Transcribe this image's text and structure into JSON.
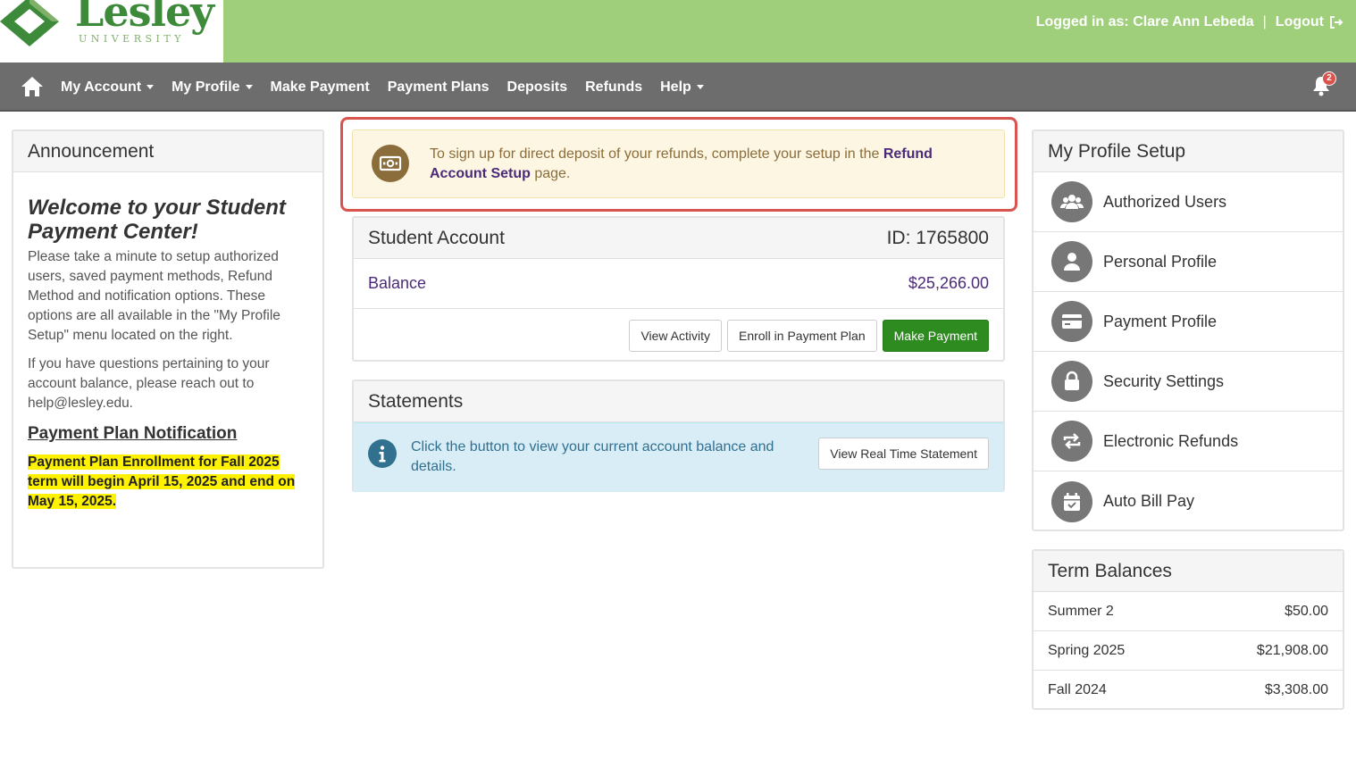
{
  "header": {
    "logo_text": "Lesley",
    "logo_sub": "UNIVERSITY",
    "logged_in_label": "Logged in as: Clare Ann Lebeda",
    "separator": "|",
    "logout_label": "Logout"
  },
  "nav": {
    "items": [
      {
        "label": "My Account",
        "dropdown": true
      },
      {
        "label": "My Profile",
        "dropdown": true
      },
      {
        "label": "Make Payment",
        "dropdown": false
      },
      {
        "label": "Payment Plans",
        "dropdown": false
      },
      {
        "label": "Deposits",
        "dropdown": false
      },
      {
        "label": "Refunds",
        "dropdown": false
      },
      {
        "label": "Help",
        "dropdown": true
      }
    ],
    "notification_count": "2"
  },
  "announcement": {
    "header": "Announcement",
    "title": "Welcome to your Student Payment Center!",
    "paragraph1": "Please take a minute to setup authorized users, saved payment methods, Refund Method  and notification options. These options are all available in the \"My Profile Setup\" menu located on the right.",
    "paragraph2": "If you have questions pertaining to your account balance, please reach out to help@lesley.edu.",
    "subheading": "Payment Plan Notification",
    "highlight": "Payment Plan Enrollment for Fall 2025 term will begin April 15, 2025 and end on May 15, 2025."
  },
  "alert": {
    "text_before": "To sign up for direct deposit of your refunds, complete your setup in the ",
    "link": "Refund Account Setup",
    "text_after": " page."
  },
  "student_account": {
    "title": "Student Account",
    "id_label": "ID: 1765800",
    "balance_label": "Balance",
    "balance_value": "$25,266.00",
    "buttons": {
      "view_activity": "View Activity",
      "enroll": "Enroll in Payment Plan",
      "make_payment": "Make Payment"
    }
  },
  "statements": {
    "title": "Statements",
    "info": "Click the button to view your current account balance and details.",
    "button": "View Real Time Statement"
  },
  "profile_setup": {
    "title": "My Profile Setup",
    "items": [
      {
        "label": "Authorized Users",
        "icon": "users-icon"
      },
      {
        "label": "Personal Profile",
        "icon": "person-icon"
      },
      {
        "label": "Payment Profile",
        "icon": "card-icon"
      },
      {
        "label": "Security Settings",
        "icon": "lock-icon"
      },
      {
        "label": "Electronic Refunds",
        "icon": "refresh-icon"
      },
      {
        "label": "Auto Bill Pay",
        "icon": "calendar-icon"
      }
    ]
  },
  "term_balances": {
    "title": "Term Balances",
    "rows": [
      {
        "term": "Summer 2",
        "amount": "$50.00"
      },
      {
        "term": "Spring 2025",
        "amount": "$21,908.00"
      },
      {
        "term": "Fall 2024",
        "amount": "$3,308.00"
      }
    ]
  },
  "colors": {
    "header_green": "#a0cf7c",
    "nav_gray": "#6d6d6d",
    "brand_purple": "#4b2a7a",
    "button_green": "#2e8b1f",
    "alert_outline": "#d9534f"
  }
}
